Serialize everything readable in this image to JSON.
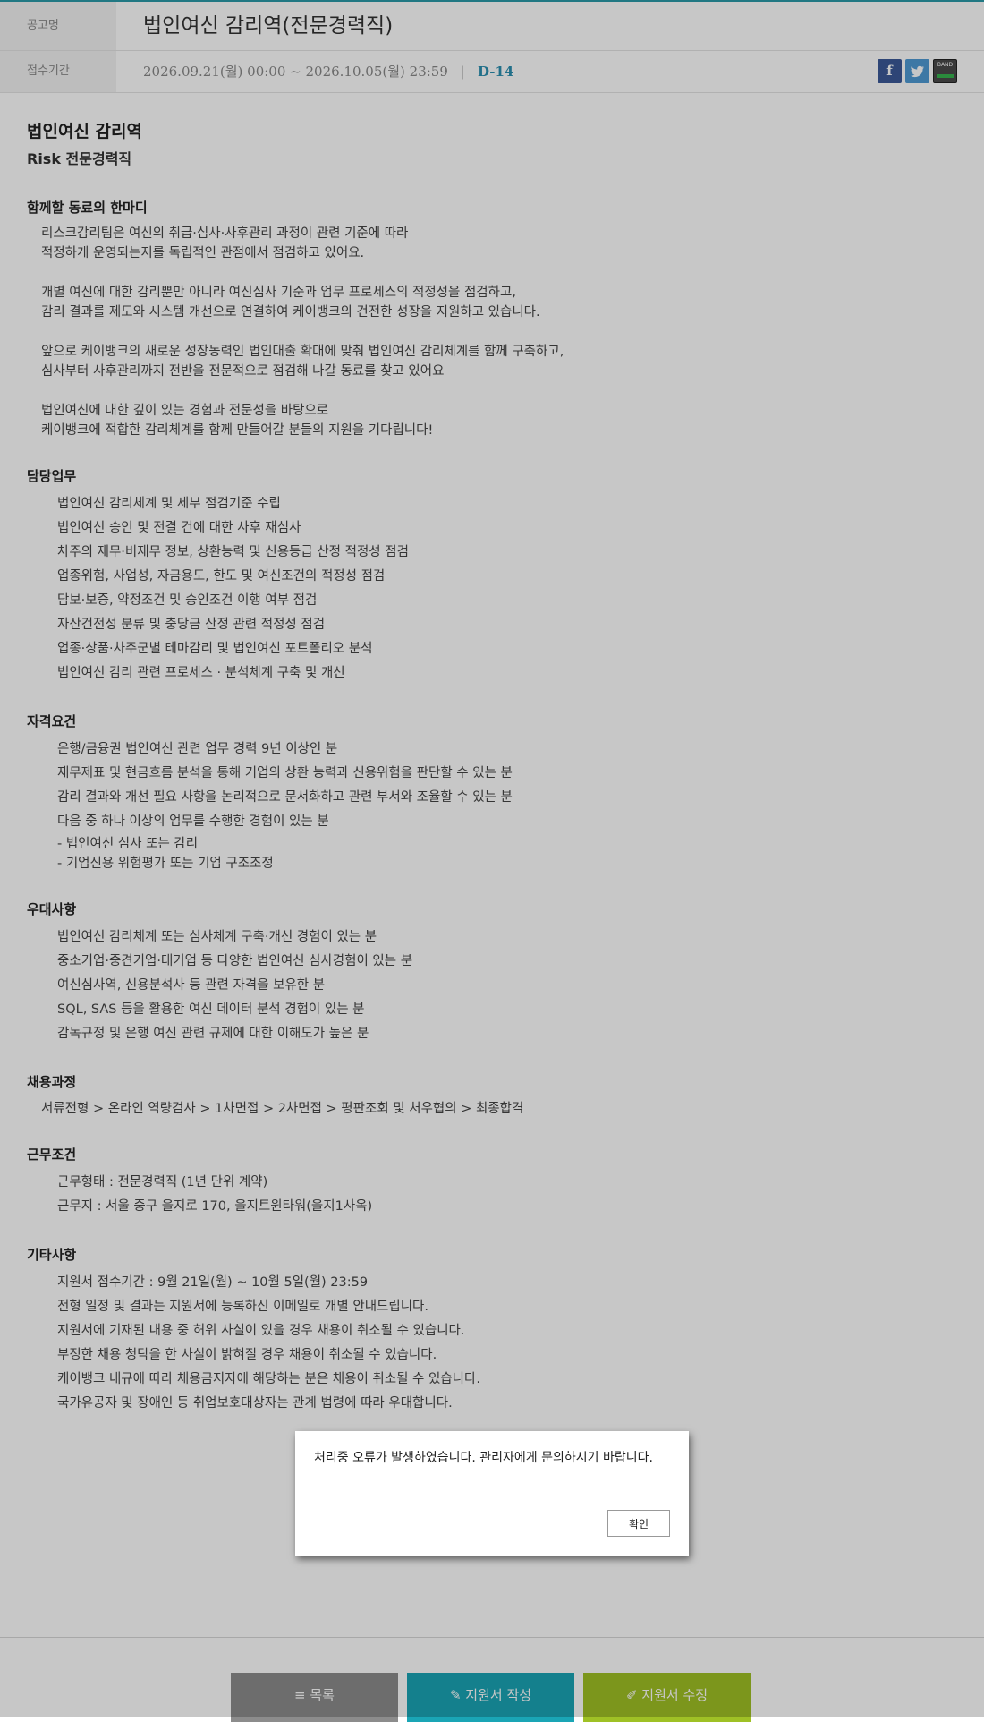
{
  "header": {
    "notice_label": "공고명",
    "notice_title": "법인여신 감리역(전문경력직)",
    "period_label": "접수기간",
    "period": "2026.09.21(월) 00:00 ~ 2026.10.05(월) 23:59",
    "period_sep": "|",
    "dday": "D-14",
    "share": {
      "facebook": "f",
      "band": "BAND"
    }
  },
  "content": {
    "title": "법인여신 감리역",
    "subtitle": "Risk 전문경력직",
    "intro_heading": "함께할 동료의 한마디",
    "intro_paragraphs": [
      [
        "리스크감리팀은 여신의 취급·심사·사후관리 과정이 관련 기준에 따라",
        "적정하게 운영되는지를 독립적인 관점에서 점검하고 있어요."
      ],
      [
        "개별 여신에 대한 감리뿐만 아니라 여신심사 기준과 업무 프로세스의 적정성을 점검하고,",
        "감리 결과를 제도와 시스템 개선으로 연결하여 케이뱅크의 건전한 성장을 지원하고 있습니다."
      ],
      [
        "앞으로 케이뱅크의 새로운 성장동력인 법인대출 확대에 맞춰 법인여신 감리체계를 함께 구축하고,",
        "심사부터 사후관리까지 전반을 전문적으로 점검해 나갈 동료를 찾고 있어요"
      ],
      [
        "법인여신에 대한 깊이 있는 경험과 전문성을 바탕으로",
        "케이뱅크에 적합한 감리체계를 함께 만들어갈 분들의 지원을 기다립니다!"
      ]
    ],
    "duties_heading": "담당업무",
    "duties": [
      "법인여신 감리체계 및 세부 점검기준 수립",
      "법인여신 승인 및 전결 건에 대한 사후 재심사",
      "차주의 재무·비재무 정보, 상환능력 및 신용등급 산정 적정성 점검",
      "업종위험, 사업성, 자금용도, 한도 및 여신조건의 적정성 점검",
      "담보·보증, 약정조건 및 승인조건 이행 여부 점검",
      "자산건전성 분류 및 충당금 산정 관련 적정성 점검",
      "업종·상품·차주군별 테마감리 및 법인여신 포트폴리오 분석",
      "법인여신 감리 관련 프로세스 · 분석체계 구축 및 개선"
    ],
    "qual_heading": "자격요건",
    "quals": [
      "은행/금융권 법인여신 관련 업무 경력 9년 이상인 분",
      "재무제표 및 현금흐름 분석을 통해 기업의 상환 능력과 신용위험을 판단할 수 있는 분",
      "감리 결과와 개선 필요 사항을 논리적으로 문서화하고 관련 부서와 조율할 수 있는 분",
      "다음 중 하나 이상의 업무를 수행한 경험이 있는 분"
    ],
    "qual_subs": [
      "- 법인여신 심사 또는 감리",
      "- 기업신용 위험평가 또는 기업 구조조정"
    ],
    "pref_heading": "우대사항",
    "prefs": [
      "법인여신 감리체계 또는 심사체계 구축·개선 경험이 있는 분",
      "중소기업·중견기업·대기업 등 다양한 법인여신 심사경험이 있는 분",
      "여신심사역, 신용분석사 등 관련 자격을 보유한 분",
      "SQL, SAS 등을 활용한 여신 데이터 분석 경험이 있는 분",
      "감독규정 및 은행 여신 관련 규제에 대한 이해도가 높은 분"
    ],
    "process_heading": "채용과정",
    "process": "서류전형 > 온라인 역량검사 > 1차면접 > 2차면접 > 평판조회 및 처우협의 > 최종합격",
    "work_heading": "근무조건",
    "work": [
      "근무형태 : 전문경력직 (1년 단위 계약)",
      "근무지 : 서울 중구 을지로 170, 을지트윈타워(을지1사옥)"
    ],
    "etc_heading": "기타사항",
    "etc": [
      "지원서 접수기간 : 9월 21일(월) ~ 10월 5일(월) 23:59",
      "전형 일정 및 결과는 지원서에 등록하신 이메일로 개별 안내드립니다.",
      "지원서에 기재된 내용 중 허위 사실이 있을 경우 채용이 취소될 수 있습니다.",
      "부정한 채용 청탁을 한 사실이 밝혀질 경우 채용이 취소될 수 있습니다.",
      "케이뱅크 내규에 따라 채용금지자에 해당하는 분은 채용이 취소될 수 있습니다.",
      "국가유공자 및 장애인 등 취업보호대상자는 관계 법령에 따라 우대합니다."
    ]
  },
  "modal": {
    "message": "처리중 오류가 발생하였습니다. 관리자에게 문의하시기 바랍니다.",
    "ok_label": "확인"
  },
  "buttons": {
    "list_label": "≡ 목록",
    "write_label": "✎ 지원서 작성",
    "edit_label": "✐ 지원서 수정"
  },
  "colors": {
    "accent": "#2b9aa8",
    "dday": "#2b8fb0",
    "btn_list": "#8c8c8c",
    "btn_write": "#1aa5b5",
    "btn_edit": "#9fc125"
  }
}
